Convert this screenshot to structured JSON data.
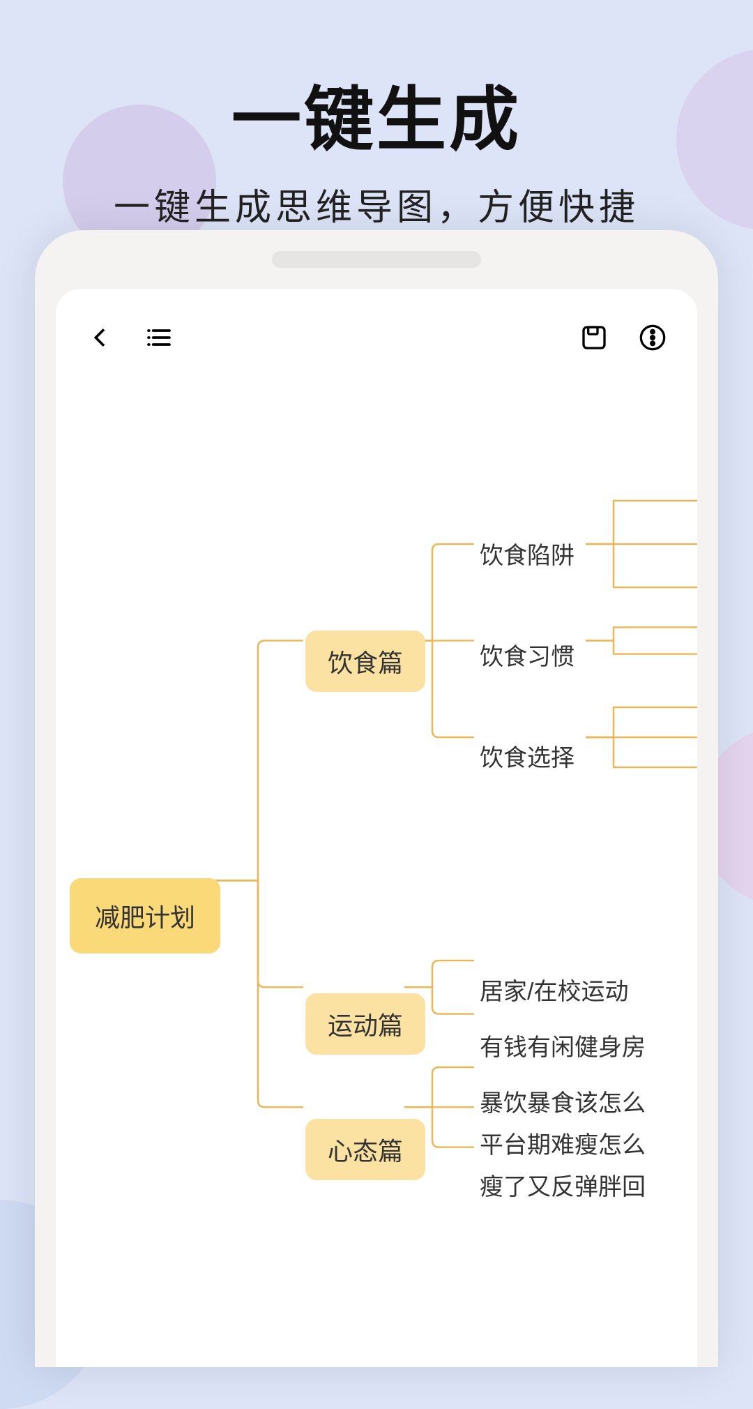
{
  "promo": {
    "title": "一键生成",
    "subtitle": "一键生成思维导图，方便快捷"
  },
  "mindmap": {
    "root": "减肥计划",
    "branches": [
      {
        "label": "饮食篇",
        "children": [
          "饮食陷阱",
          "饮食习惯",
          "饮食选择"
        ]
      },
      {
        "label": "运动篇",
        "children": [
          "居家/在校运动",
          "有钱有闲健身房"
        ]
      },
      {
        "label": "心态篇",
        "children": [
          "暴饮暴食该怎么",
          "平台期难瘦怎么",
          "瘦了又反弹胖回"
        ]
      }
    ]
  }
}
